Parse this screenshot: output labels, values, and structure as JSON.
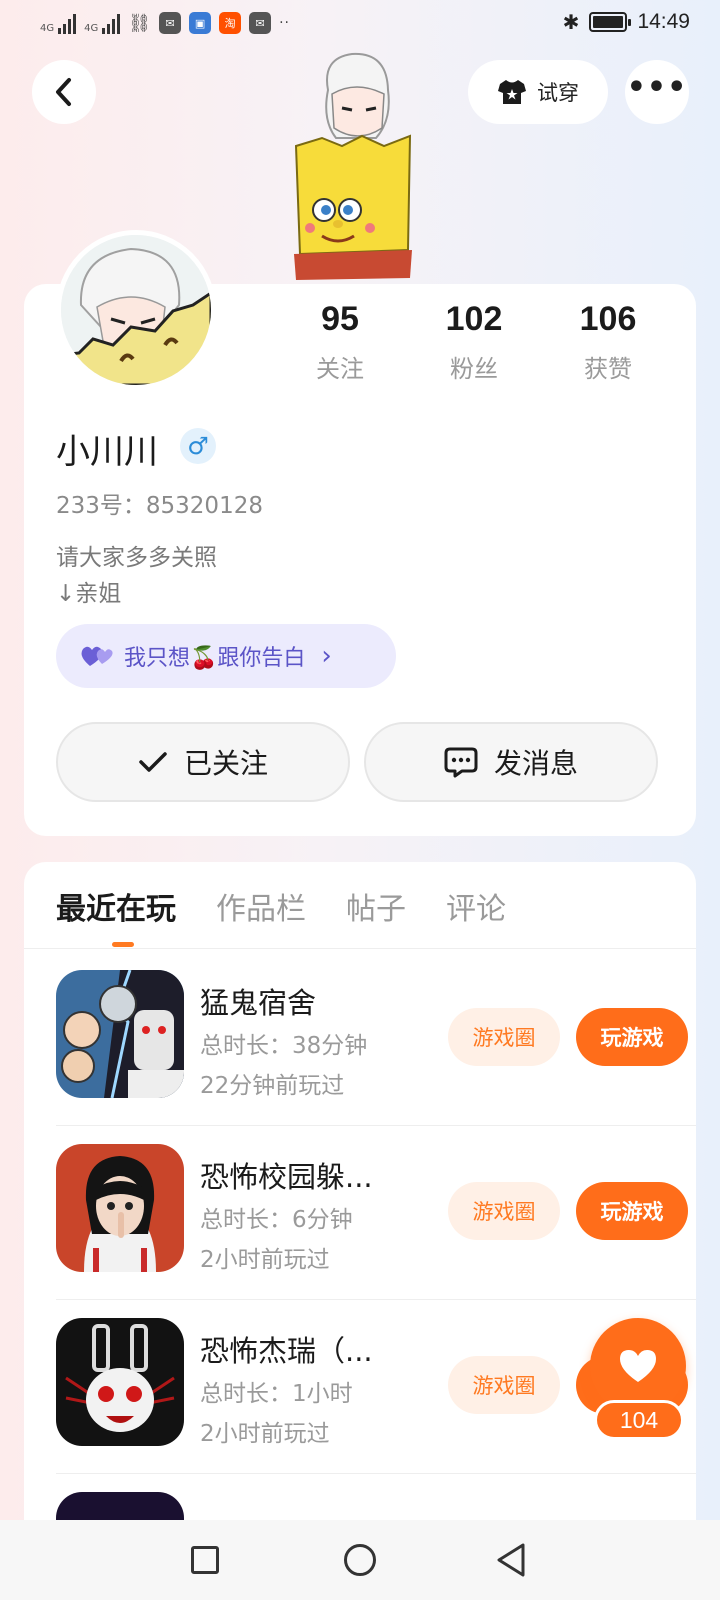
{
  "status_bar": {
    "time": "14:49",
    "network_1": "4G",
    "network_2": "4G",
    "app_taobao": "淘",
    "dots": "··"
  },
  "header": {
    "try_on_label": "试穿",
    "more_label": "•••"
  },
  "profile": {
    "username": "小川川",
    "gender_symbol": "♂",
    "uid_text": "233号：85320128",
    "bio_line1": "请大家多多关照",
    "bio_line2": "↓亲姐",
    "confess_text": "我只想🍒跟你告白",
    "confess_arrow": "›",
    "stats": [
      {
        "value": "95",
        "label": "关注"
      },
      {
        "value": "102",
        "label": "粉丝"
      },
      {
        "value": "106",
        "label": "获赞"
      }
    ],
    "follow_label": "已关注",
    "message_label": "发消息"
  },
  "tabs": [
    {
      "label": "最近在玩",
      "active": true
    },
    {
      "label": "作品栏",
      "active": false
    },
    {
      "label": "帖子",
      "active": false
    },
    {
      "label": "评论",
      "active": false
    }
  ],
  "games": [
    {
      "name": "猛鬼宿舍",
      "duration": "总时长：38分钟",
      "last_played": "22分钟前玩过",
      "circle_label": "游戏圈",
      "play_label": "玩游戏"
    },
    {
      "name": "恐怖校园躲...",
      "duration": "总时长：6分钟",
      "last_played": "2小时前玩过",
      "circle_label": "游戏圈",
      "play_label": "玩游戏"
    },
    {
      "name": "恐怖杰瑞（...",
      "duration": "总时长：1小时",
      "last_played": "2小时前玩过",
      "circle_label": "游戏圈",
      "play_label": "玩游戏"
    }
  ],
  "like_fab": {
    "count": "104"
  },
  "colors": {
    "accent": "#ff6d1a",
    "accent_light": "#fff0e6",
    "confess_bg": "#ecebfd",
    "confess_text": "#5b54c7"
  }
}
